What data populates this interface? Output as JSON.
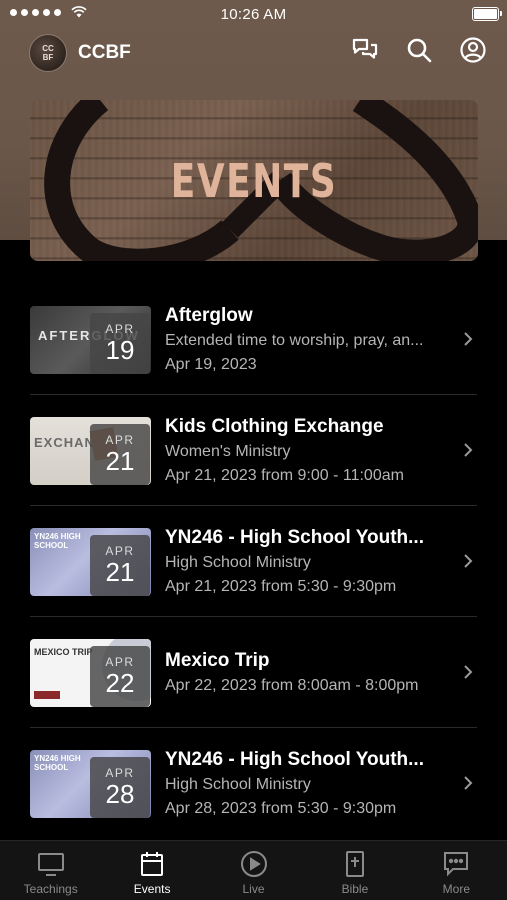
{
  "status_bar": {
    "time": "10:26 AM"
  },
  "header": {
    "logo_text": "CC BF",
    "title": "CCBF",
    "icons": [
      "chat-icon",
      "search-icon",
      "profile-icon"
    ]
  },
  "banner": {
    "title": "EVENTS"
  },
  "events": [
    {
      "title": "Afterglow",
      "subtitle": "Extended time to worship, pray, an...",
      "date_line": "Apr 19, 2023",
      "month": "APR",
      "day": "19",
      "thumb_caption": "AFTERGLOW"
    },
    {
      "title": "Kids Clothing Exchange",
      "subtitle": "Women's Ministry",
      "date_line": "Apr 21, 2023 from 9:00 - 11:00am",
      "month": "APR",
      "day": "21",
      "thumb_caption": "EXCHANGE"
    },
    {
      "title": "YN246 - High School Youth...",
      "subtitle": "High School Ministry",
      "date_line": "Apr 21, 2023 from 5:30 - 9:30pm",
      "month": "APR",
      "day": "21",
      "thumb_caption": "YN246 HIGH SCHOOL"
    },
    {
      "title": "Mexico Trip",
      "subtitle": "Apr 22, 2023 from 8:00am - 8:00pm",
      "date_line": "",
      "month": "APR",
      "day": "22",
      "thumb_caption": "MEXICO TRIP"
    },
    {
      "title": "YN246 - High School Youth...",
      "subtitle": "High School Ministry",
      "date_line": "Apr 28, 2023 from 5:30 - 9:30pm",
      "month": "APR",
      "day": "28",
      "thumb_caption": "YN246 HIGH SCHOOL"
    }
  ],
  "tabs": [
    {
      "label": "Teachings",
      "icon": "tv-icon",
      "active": false
    },
    {
      "label": "Events",
      "icon": "calendar-icon",
      "active": true
    },
    {
      "label": "Live",
      "icon": "play-icon",
      "active": false
    },
    {
      "label": "Bible",
      "icon": "bible-icon",
      "active": false
    },
    {
      "label": "More",
      "icon": "more-icon",
      "active": false
    }
  ],
  "colors": {
    "header_brown": "#6e5a4c",
    "banner_title": "#e0b49a",
    "background": "#000000",
    "tab_bar": "#141414"
  }
}
